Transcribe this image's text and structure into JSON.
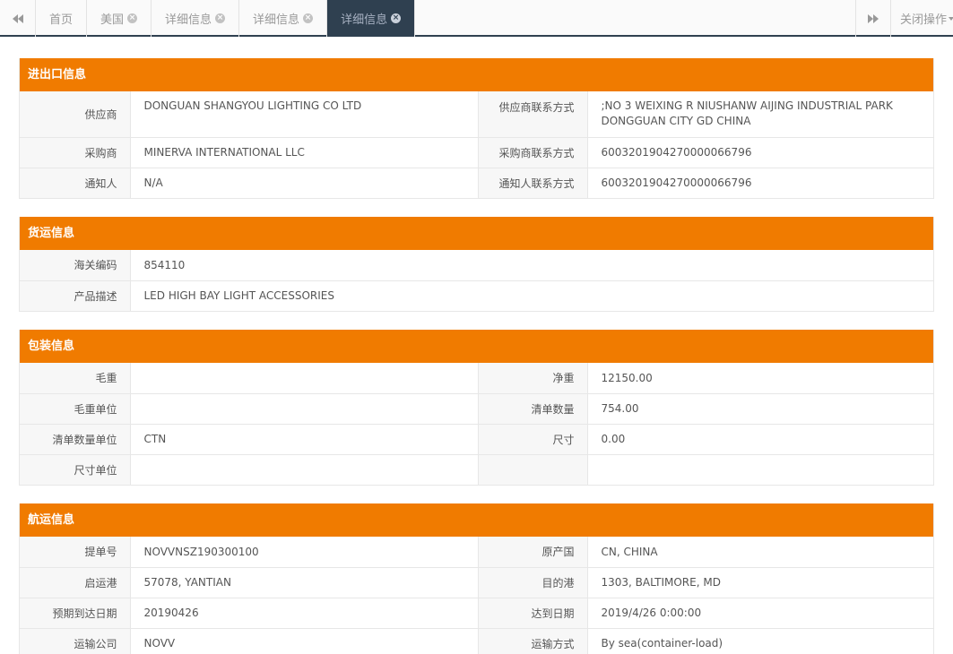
{
  "tabs": {
    "items": [
      {
        "label": "首页",
        "closable": false
      },
      {
        "label": "美国",
        "closable": true
      },
      {
        "label": "详细信息",
        "closable": true
      },
      {
        "label": "详细信息",
        "closable": true
      },
      {
        "label": "详细信息",
        "closable": true,
        "active": true
      }
    ],
    "close_ops_label": "关闭操作"
  },
  "colors": {
    "accent": "#f07b00",
    "tab_active_bg": "#2f4050"
  },
  "import_export": {
    "title": "进出口信息",
    "rows": [
      {
        "l1": "供应商",
        "v1": "DONGUAN SHANGYOU LIGHTING CO LTD",
        "l2": "供应商联系方式",
        "v2a": ";NO 3 WEIXING R NIUSHANW AIJING INDUSTRIAL PARK",
        "v2b": "DONGGUAN CITY GD CHINA"
      },
      {
        "l1": "采购商",
        "v1": "MINERVA INTERNATIONAL LLC",
        "l2": "采购商联系方式",
        "v2": "6003201904270000066796"
      },
      {
        "l1": "通知人",
        "v1": "N/A",
        "l2": "通知人联系方式",
        "v2": "6003201904270000066796"
      }
    ]
  },
  "cargo": {
    "title": "货运信息",
    "rows": [
      {
        "l": "海关编码",
        "v": "854110"
      },
      {
        "l": "产品描述",
        "v": "LED HIGH BAY LIGHT ACCESSORIES"
      }
    ]
  },
  "packing": {
    "title": "包装信息",
    "rows": [
      {
        "l1": "毛重",
        "v1": "",
        "l2": "净重",
        "v2": "12150.00"
      },
      {
        "l1": "毛重单位",
        "v1": "",
        "l2": "清单数量",
        "v2": "754.00"
      },
      {
        "l1": "清单数量单位",
        "v1": "CTN",
        "l2": "尺寸",
        "v2": "0.00"
      },
      {
        "l1": "尺寸单位",
        "v1": "",
        "l2": "",
        "v2": ""
      }
    ]
  },
  "shipping": {
    "title": "航运信息",
    "rows": [
      {
        "l1": "提单号",
        "v1": "NOVVNSZ190300100",
        "l2": "原产国",
        "v2": "CN, CHINA"
      },
      {
        "l1": "启运港",
        "v1": "57078, YANTIAN",
        "l2": "目的港",
        "v2": "1303, BALTIMORE, MD"
      },
      {
        "l1": "预期到达日期",
        "v1": "20190426",
        "l2": "达到日期",
        "v2": "2019/4/26 0:00:00"
      },
      {
        "l1": "运输公司",
        "v1": "NOVV",
        "l2": "运输方式",
        "v2": "By sea(container-load)"
      }
    ]
  }
}
